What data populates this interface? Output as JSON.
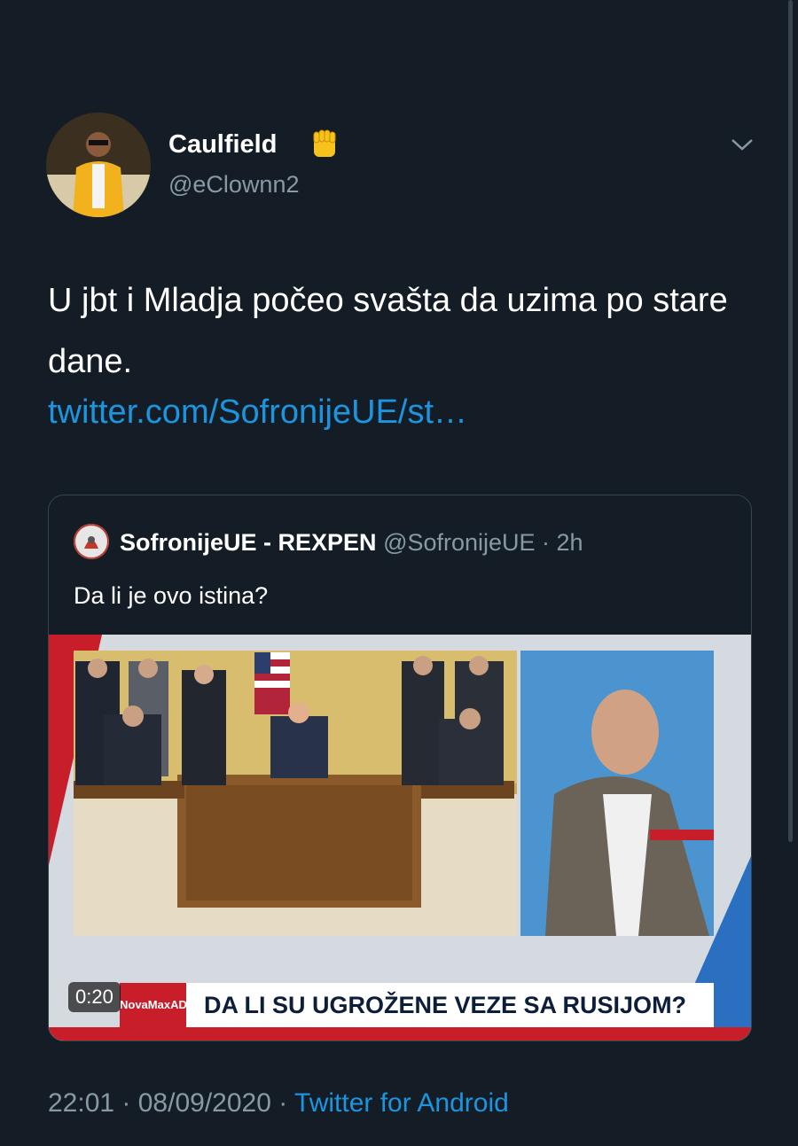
{
  "tweet": {
    "display_name": "Caulfield",
    "emoji_icon": "raised-fist-icon",
    "handle": "@eClownn2",
    "text": "U jbt i Mladja počeo svašta da uzima po stare dane.",
    "link": "twitter.com/SofronijeUE/st…"
  },
  "quoted": {
    "display_name": "SofronijeUE - REXPEN",
    "handle_time": "@SofronijeUE · 2h",
    "text": "Da li je ovo istina?",
    "video": {
      "duration": "0:20",
      "channel": "NovaMaxADRIA",
      "headline": "DA LI SU UGROŽENE VEZE SA RUSIJOM?"
    }
  },
  "footer": {
    "time": "22:01",
    "date": "08/09/2020",
    "source": "Twitter for Android"
  },
  "colors": {
    "background": "#141d26",
    "link": "#1b95e0",
    "muted": "#8899a6",
    "accent_red": "#c81e2a"
  }
}
